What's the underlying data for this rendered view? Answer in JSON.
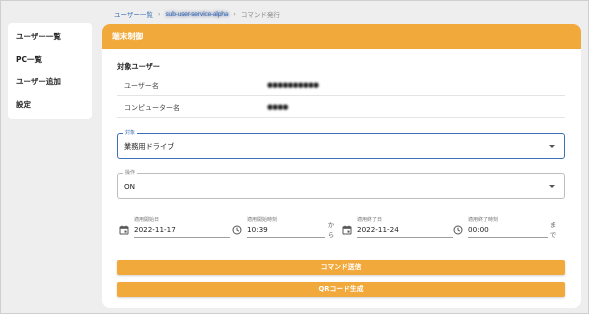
{
  "breadcrumb": {
    "item1": "ユーザー一覧",
    "sep": "›",
    "item2": "sub-user-service-alpha",
    "item3": "コマンド発行"
  },
  "sidebar": {
    "items": [
      {
        "label": "ユーザー一覧"
      },
      {
        "label": "PC一覧"
      },
      {
        "label": "ユーザー追加"
      },
      {
        "label": "設定"
      }
    ]
  },
  "card": {
    "title": "端末制御",
    "section_title": "対象ユーザー",
    "user_name_label": "ユーザー名",
    "user_name_value": "●●●●●●●●●●",
    "computer_name_label": "コンピューター名",
    "computer_name_value": "●●●●"
  },
  "form": {
    "target_label": "対象",
    "target_value": "業務用ドライブ",
    "operation_label": "操作",
    "operation_value": "ON",
    "start_date_label": "適用開始日",
    "start_date_value": "2022-11-17",
    "start_time_label": "適用開始時刻",
    "start_time_value": "10:39",
    "from_text": "から",
    "end_date_label": "適用終了日",
    "end_date_value": "2022-11-24",
    "end_time_label": "適用終了時刻",
    "end_time_value": "00:00",
    "until_text": "まで"
  },
  "buttons": {
    "send_command": "コマンド送信",
    "qr_generate": "QRコード生成"
  },
  "colors": {
    "accent": "#f2a93b",
    "focus": "#3b6fb6"
  }
}
